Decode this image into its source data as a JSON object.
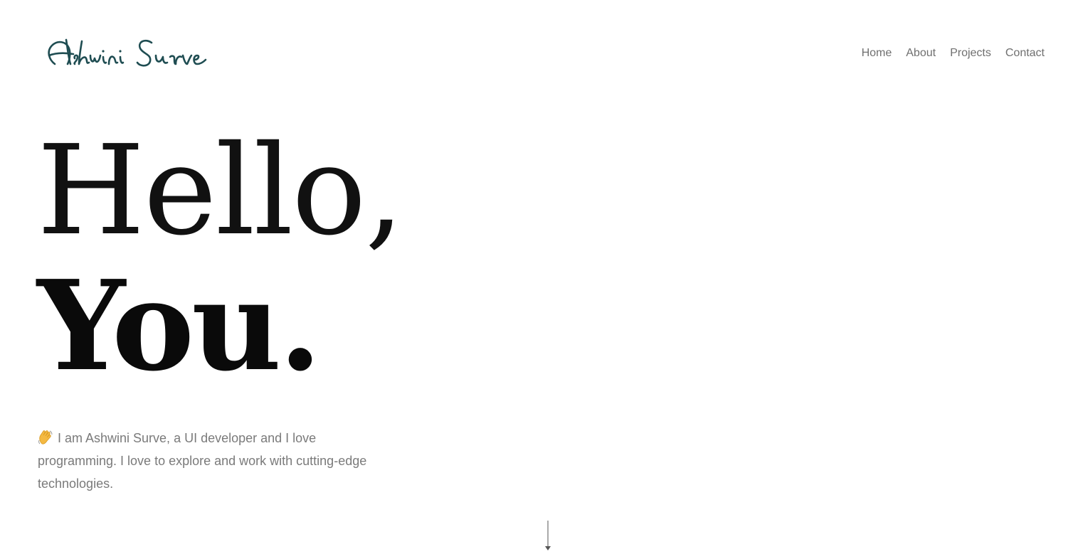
{
  "header": {
    "logo_text": "Ashwini Surve",
    "nav": [
      {
        "label": "Home"
      },
      {
        "label": "About"
      },
      {
        "label": "Projects"
      },
      {
        "label": "Contact"
      }
    ]
  },
  "hero": {
    "line1": "Hello,",
    "line2": "You.",
    "intro": "I am Ashwini Surve, a UI developer and I love programming. I love to explore and work with cutting-edge technologies.",
    "intro_icon": "waving-hand-icon"
  },
  "scroll_indicator": {
    "icon": "arrow-down-icon"
  },
  "colors": {
    "logo": "#1f4d52",
    "nav_text": "#6f6f6f",
    "heading": "#0a0a0a",
    "body_text": "#7a7a7a"
  }
}
